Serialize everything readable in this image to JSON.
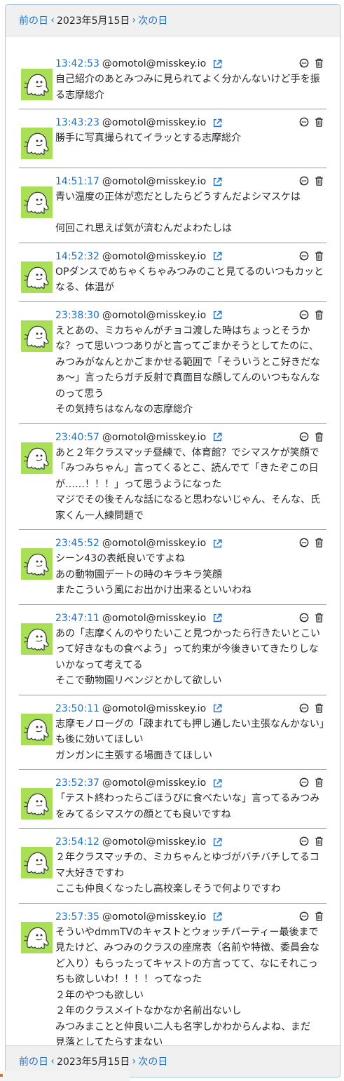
{
  "nav": {
    "prev_label": "前の日",
    "date": "2023年5月15日",
    "next_label": "次の日"
  },
  "colors": {
    "accent": "#1a73c8",
    "avatar_bg": "#a8df56",
    "nav_bg": "#f0f0f0",
    "border": "#a9c6e6"
  },
  "icons": {
    "external_link": "external-link-icon",
    "reply": "speech-bubble-icon",
    "delete": "trash-icon",
    "prev": "chevron-left-icon",
    "next": "chevron-right-icon"
  },
  "posts": [
    {
      "time": "13:42:53",
      "user": "@omotol@misskey.io",
      "text": "自己紹介のあとみつみに見られてよく分かんないけど手を振る志摩総介"
    },
    {
      "time": "13:43:23",
      "user": "@omotol@misskey.io",
      "text": "勝手に写真撮られてイラッとする志摩総介\n "
    },
    {
      "time": "14:51:17",
      "user": "@omotol@misskey.io",
      "text": "青い温度の正体が恋だとしたらどうすんだよシマスケは\n\n何回これ思えば気が済むんだよわたしは"
    },
    {
      "time": "14:52:32",
      "user": "@omotol@misskey.io",
      "text": "OPダンスでめちゃくちゃみつみのこと見てるのいつもカッとなる、体温が"
    },
    {
      "time": "23:38:30",
      "user": "@omotol@misskey.io",
      "text": "えとあの、ミカちゃんがチョコ渡した時はちょっとそうかな？って思いつつありがと言ってごまかそうとしてたのに、みつみがなんとかごまかせる範囲で「そういうとこ好きだなぁ～」言ったらガチ反射で真面目な顔してんのいつもなんなのって思う\nその気持ちはなんなの志摩総介"
    },
    {
      "time": "23:40:57",
      "user": "@omotol@misskey.io",
      "text": "あと２年クラスマッチ昼練で、体育館？でシマスケが笑顔で「みつみちゃん」言ってくるとこ、読んでて「きたぞこの日が……！！！」って思うようになった\nマジでその後そんな話になると思わないじゃん、そんな、氏家くん一人練問題で"
    },
    {
      "time": "23:45:52",
      "user": "@omotol@misskey.io",
      "text": "シーン43の表紙良いですよね\nあの動物園デートの時のキラキラ笑顔\nまたこういう風にお出かけ出来るといいわね"
    },
    {
      "time": "23:47:11",
      "user": "@omotol@misskey.io",
      "text": "あの「志摩くんのやりたいこと見つかったら行きたいとこいって好きなもの食べよう」って約束が今後きいてきたりしないかなって考えてる\nそこで動物園リベンジとかして欲しい"
    },
    {
      "time": "23:50:11",
      "user": "@omotol@misskey.io",
      "text": "志摩モノローグの「疎まれても押し通したい主張なんかない」も後に効いてほしい\nガンガンに主張する場面きてほしい"
    },
    {
      "time": "23:52:37",
      "user": "@omotol@misskey.io",
      "text": "「テスト終わったらごほうびに食べたいな」言ってるみつみをみてるシマスケの顔とても良いですね"
    },
    {
      "time": "23:54:12",
      "user": "@omotol@misskey.io",
      "text": "２年クラスマッチの、ミカちゃんとゆづがバチバチしてるコマ大好きですわ\nここも仲良くなったし高校楽しそうで何よりですわ"
    },
    {
      "time": "23:57:35",
      "user": "@omotol@misskey.io",
      "text": "そういやdmmTVのキャストとウォッチパーティー最後まで見たけど、みつみのクラスの座席表（名前や特徴、委員会など入り）もらったってキャストの方言ってて、なにそれこっちも欲しいわ！！！！ってなった\n２年のやつも欲しい\n２年のクラスメイトなかなか名前出ないし\nみつみまことと仲良い二人も名字しかわからんよね、まだ\n見落としてたらすまない"
    }
  ]
}
